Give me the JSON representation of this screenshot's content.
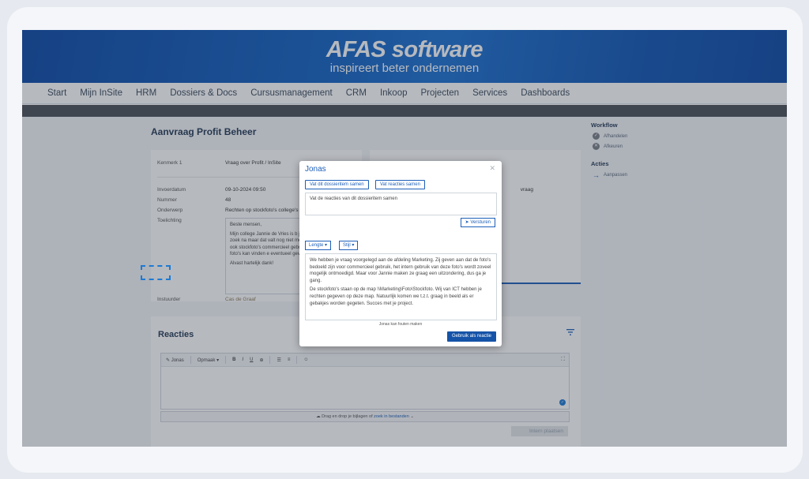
{
  "brand": {
    "name": "AFAS software",
    "tagline": "inspireert beter ondernemen"
  },
  "nav": [
    "Start",
    "Mijn InSite",
    "HRM",
    "Dossiers & Docs",
    "Cursusmanagement",
    "CRM",
    "Inkoop",
    "Projecten",
    "Services",
    "Dashboards"
  ],
  "page": {
    "title": "Aanvraag Profit Beheer",
    "kenmerk_label": "Kenmerk 1",
    "kenmerk_value": "Vraag over Profit / InSite",
    "fields": [
      {
        "label": "Invoerdatum",
        "value": "09-10-2024 09:50"
      },
      {
        "label": "Nummer",
        "value": "48"
      },
      {
        "label": "Onderwerp",
        "value": "Rechten op stockfoto's college's"
      },
      {
        "label": "Toelichting",
        "value": ""
      }
    ],
    "toelichting": [
      "Beste mensen,",
      "Mijn college Jannie de Vries is b jaar in dienst. Ik ben op zoek na maar dat valt nog niet mee... N begrepen dat er ook stockfoto's commercieel gebruik. Kunnen j waar ik deze foto's kan vinden e eventueel geven?",
      "Alvast hartelijk dank!"
    ],
    "instuurder_label": "Instuurder",
    "instuurder_value": "Cas de Graaf",
    "card2_label": "vraag"
  },
  "sidebar": {
    "workflow_title": "Workflow",
    "workflow_items": [
      "Afhandelen",
      "Afkeuren"
    ],
    "acties_title": "Acties",
    "acties_items": [
      "Aanpassen"
    ]
  },
  "reacties": {
    "title": "Reacties",
    "toolbar": {
      "jonas": "Jonas",
      "opmaak": "Opmaak",
      "bold": "B",
      "italic": "I",
      "underline": "U"
    },
    "dropzone_text": "Drag en drop je bijlagen of",
    "dropzone_link": "zoek in bestanden",
    "intern_button": "Intern plaatsen"
  },
  "modal": {
    "title": "Jonas",
    "btn_summarize_item": "Vat dit dossieritem samen",
    "btn_summarize_replies": "Vat reacties samen",
    "input_value": "Vat de reacties van dit dossieritem samen",
    "send_button": "Versturen",
    "dropdown_length": "Lengte",
    "dropdown_style": "Stijl",
    "output_paragraphs": [
      "We hebben je vraag voorgelegd aan de afdeling Marketing. Zij geven aan dat de foto's bedoeld zijn voor commercieel gebruik, het intern gebruik van deze foto's wordt zoveel mogelijk ontmoedigd. Maar voor Jannie maken ze graag een uitzondering, dus ga je gang.",
      "De stockfoto's staan op de map \\\\Marketing\\Foto\\Stockfoto. Wij van ICT hebben je rechten gegeven op deze map. Natuurlijk komen we t.z.t. graag in beeld als er gebakjes worden gegeten. Succes met je project."
    ],
    "note": "Jonas kan fouten maken",
    "use_button": "Gebruik als reactie"
  },
  "colors": {
    "brand_blue": "#1261c2",
    "accent": "#1d5fb8",
    "overlay": "rgba(45,55,70,0.35)"
  }
}
